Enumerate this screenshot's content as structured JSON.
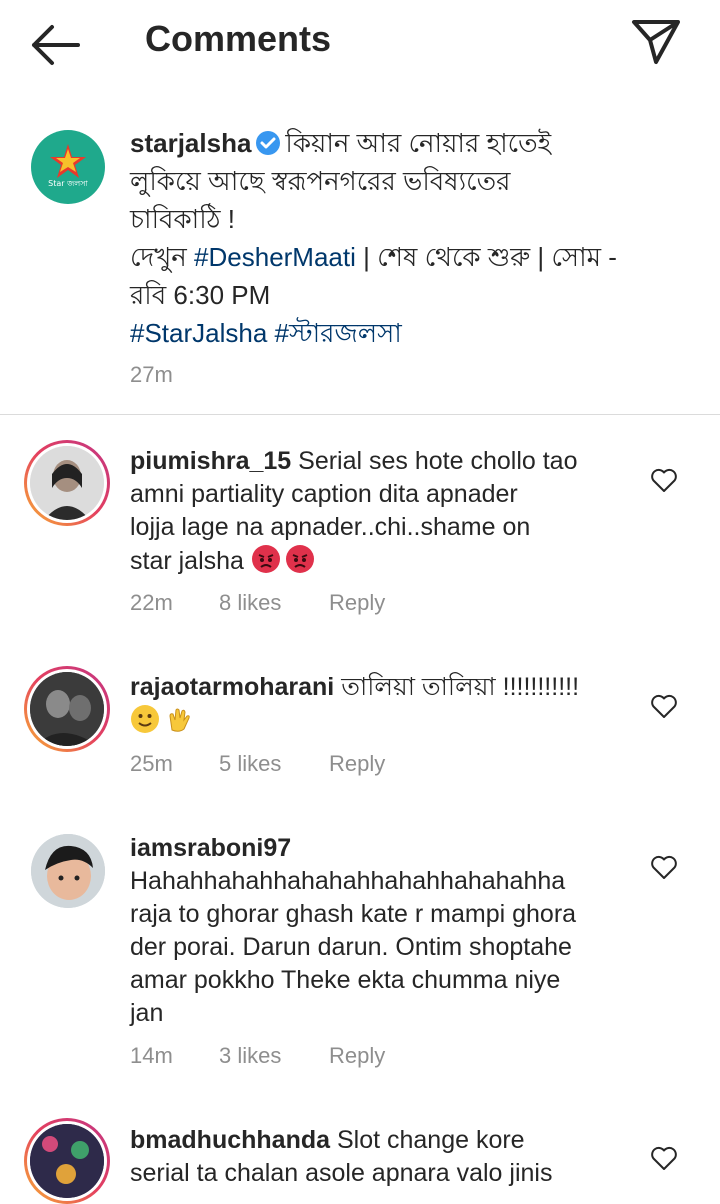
{
  "header": {
    "title": "Comments"
  },
  "caption": {
    "username": "starjalsha",
    "logo_text": "Star জলসা",
    "line1": "কিয়ান আর নোয়ার হাতেই",
    "line2": "লুকিয়ে আছে স্বরূপনগরের ভবিষ্যতের",
    "line3": "চাবিকাঠি !",
    "line4_prefix": "দেখুন ",
    "line4_tag": "#DesherMaati",
    "line4_suffix": " | শেষ থেকে শুরু | সোম -",
    "line5": "রবি 6:30 PM",
    "tag1": "#StarJalsha",
    "tag2": "#স্টারজলসা",
    "time": "27m"
  },
  "comments": [
    {
      "username": "piumishra_15",
      "lines": [
        "Serial ses hote chollo tao",
        "amni partiality caption dita apnader",
        "lojja lage na apnader..chi..shame on",
        "star jalsha"
      ],
      "time": "22m",
      "likes": "8 likes",
      "reply": "Reply"
    },
    {
      "username": "rajaotarmoharani",
      "lines": [
        "তালিয়া তালিয়া !!!!!!!!!!!"
      ],
      "time": "25m",
      "likes": "5 likes",
      "reply": "Reply"
    },
    {
      "username": "iamsraboni97",
      "lines": [
        "Hahahhahahhahahahhahahhahahahha",
        "raja to ghorar ghash kate r mampi ghora",
        "der porai. Darun darun. Ontim shoptahe",
        "amar pokkho Theke ekta chumma niye",
        "jan"
      ],
      "time": "14m",
      "likes": "3 likes",
      "reply": "Reply"
    },
    {
      "username": "bmadhuchhanda",
      "lines": [
        "Slot change kore",
        "serial ta chalan asole apnara valo jinis"
      ]
    }
  ]
}
